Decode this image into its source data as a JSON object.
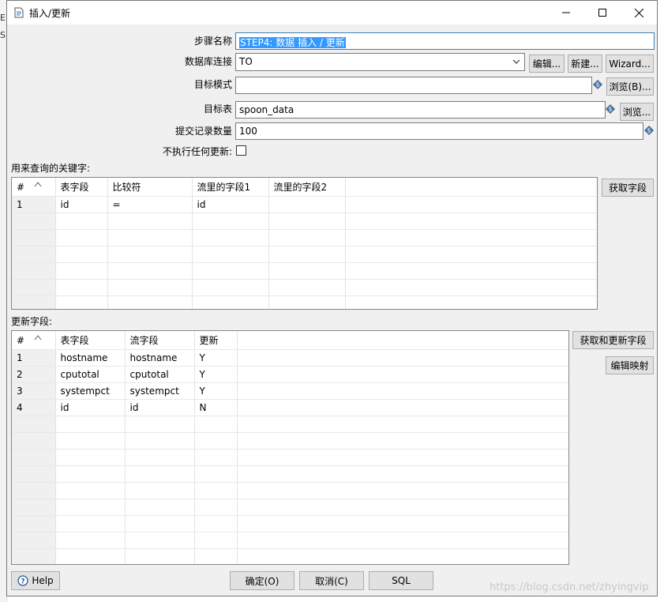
{
  "dialog": {
    "title": "插入/更新",
    "ok_label": "确定(O)",
    "cancel_label": "取消(C)",
    "sql_label": "SQL",
    "help_label": "Help"
  },
  "form": {
    "step_name_label": "步骤名称",
    "step_name_value": "STEP4: 数据 插入 / 更新",
    "connection_label": "数据库连接",
    "connection_value": "TO",
    "edit_label": "编辑...",
    "new_label": "新建...",
    "wizard_label": "Wizard...",
    "schema_label": "目标模式",
    "schema_value": "",
    "browse_schema_label": "浏览(B)...",
    "table_label": "目标表",
    "table_value": "spoon_data",
    "browse_table_label": "浏览...",
    "commit_label": "提交记录数量",
    "commit_value": "100",
    "no_update_label": "不执行任何更新:"
  },
  "keys": {
    "section_label": "用来查询的关键字:",
    "get_fields_label": "获取字段",
    "columns": [
      "#",
      "表字段",
      "比较符",
      "流里的字段1",
      "流里的字段2"
    ],
    "rows": [
      [
        "1",
        "id",
        "=",
        "id",
        ""
      ]
    ]
  },
  "updates": {
    "section_label": "更新字段:",
    "get_update_fields_label": "获取和更新字段",
    "edit_mapping_label": "编辑映射",
    "columns": [
      "#",
      "表字段",
      "流字段",
      "更新"
    ],
    "rows": [
      [
        "1",
        "hostname",
        "hostname",
        "Y"
      ],
      [
        "2",
        "cputotal",
        "cputotal",
        "Y"
      ],
      [
        "3",
        "systempct",
        "systempct",
        "Y"
      ],
      [
        "4",
        "id",
        "id",
        "N"
      ]
    ]
  },
  "watermark": "https://blog.csdn.net/zhyingvip",
  "desk_fragments": [
    "E",
    "S"
  ],
  "colors": {
    "selection": "#3399ff",
    "highlight_header": "#cce8ff",
    "default_button_border": "#0078d7"
  }
}
